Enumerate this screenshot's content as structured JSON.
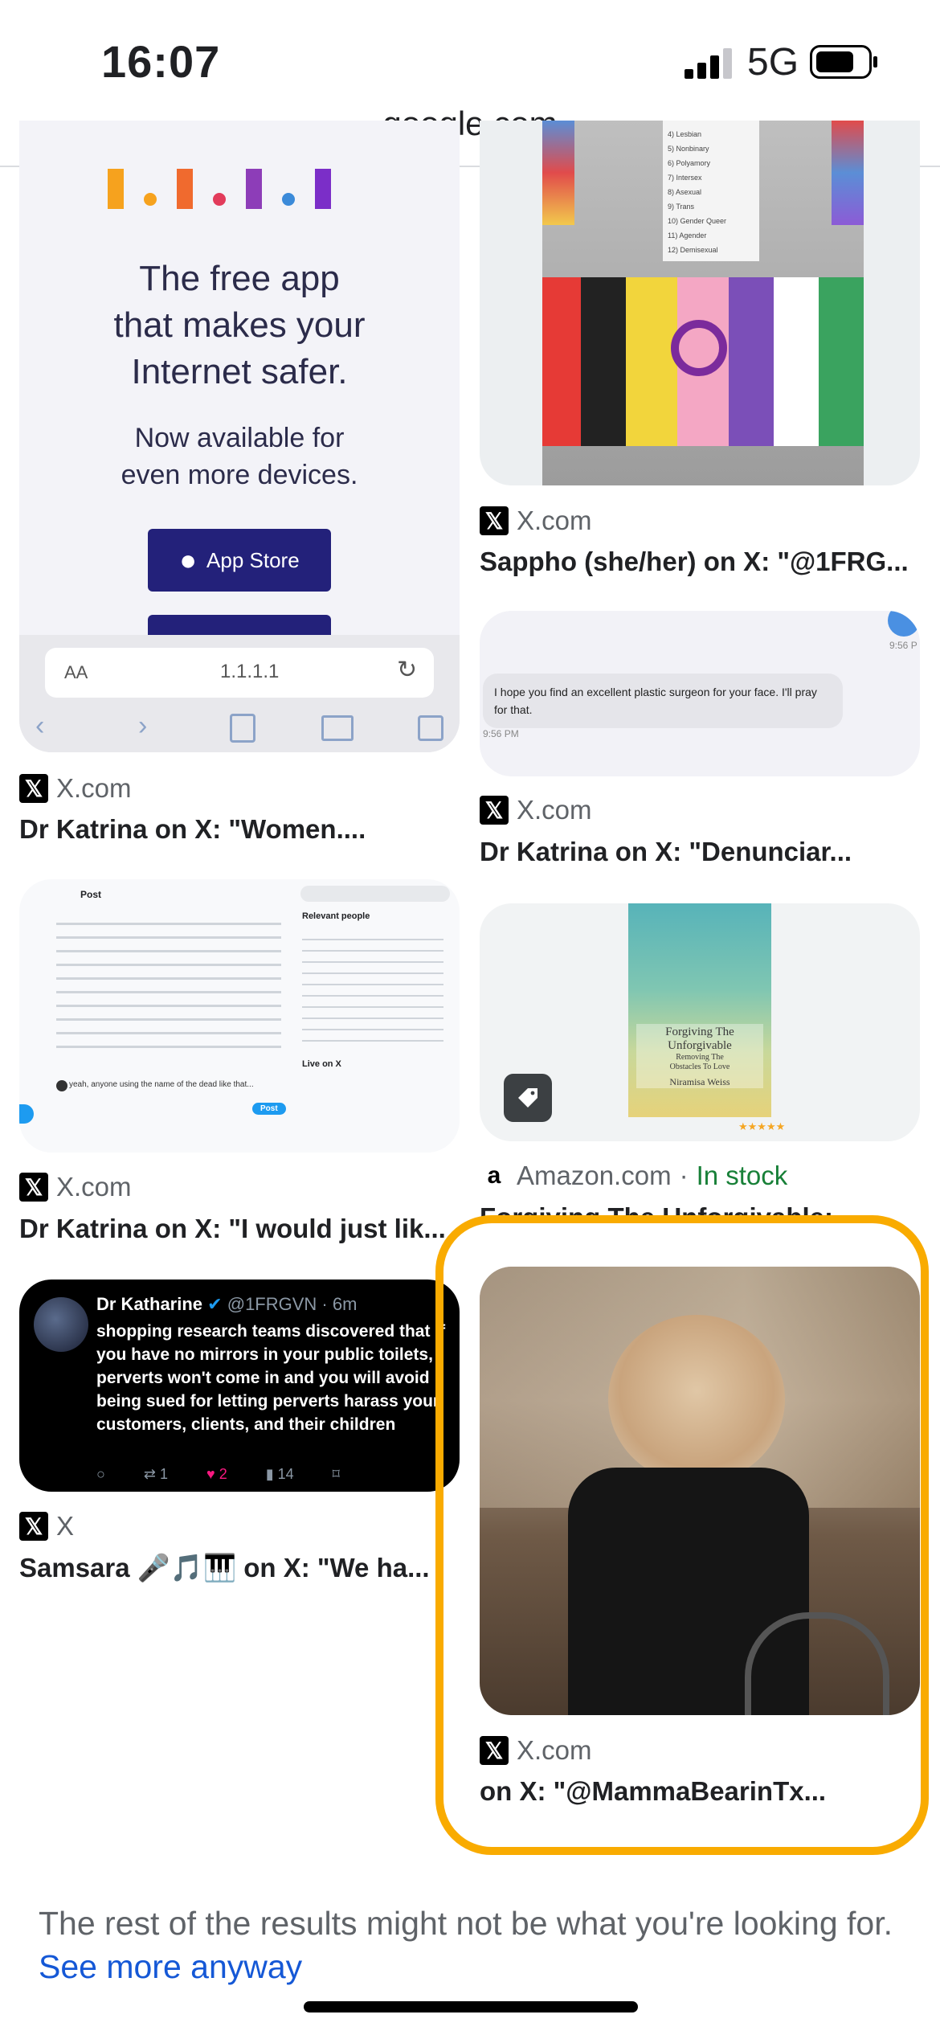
{
  "status": {
    "time": "16:07",
    "network": "5G"
  },
  "browser": {
    "url": "google.com"
  },
  "results": [
    {
      "source": "X.com",
      "title": "Dr Katrina on X: \"Women....",
      "image_text": {
        "line1": "The free app",
        "line2": "that makes your",
        "line3": "Internet safer.",
        "line4": "Now available for",
        "line5": "even more devices.",
        "button": "App Store",
        "address": "1.1.1.1",
        "aa": "AA"
      }
    },
    {
      "source": "X.com",
      "title": "Sappho (she/her) on X: \"@1FRG...",
      "image_text": {
        "list": [
          "4) Lesbian",
          "5) Nonbinary",
          "6) Polyamory",
          "7) Intersex",
          "8) Asexual",
          "9) Trans",
          "10) Gender Queer",
          "11) Agender",
          "12) Demisexual"
        ]
      }
    },
    {
      "source": "X.com",
      "title": "Dr Katrina on X: \"Denunciar...",
      "image_text": {
        "message": "I hope you find an excellent plastic surgeon for your face. I'll pray for that.",
        "time_left": "9:56 PM",
        "time_right": "9:56 P"
      }
    },
    {
      "source": "X.com",
      "title": "Dr Katrina on X: \"I would just lik...",
      "image_text": {
        "post": "Post",
        "relevant": "Relevant people",
        "live": "Live on X",
        "reply": "yeah, anyone using the name of the dead like that...",
        "post_button": "Post"
      }
    },
    {
      "source": "Amazon.com",
      "stock": "In stock",
      "title": "Forgiving The Unforgivable:",
      "image_text": {
        "book_title_1": "Forgiving The",
        "book_title_2": "Unforgivable",
        "book_sub_1": "Removing The",
        "book_sub_2": "Obstacles To Love",
        "author": "Niramisa Weiss",
        "stars": "★★★★★"
      }
    },
    {
      "source": "X",
      "title": "Samsara 🎤🎵🎹 on X: \"We ha...",
      "image_text": {
        "name": "Dr Katharine",
        "handle": "@1FRGVN · 6m",
        "body": "shopping research teams discovered that if you have no mirrors in your public toilets, perverts won't come in and you will avoid being sued for letting perverts harass your customers, clients, and their children",
        "retweets": "1",
        "likes": "2",
        "views": "14"
      }
    },
    {
      "source": "X.com",
      "title": "on X: \"@MammaBearinTx..."
    }
  ],
  "footer": {
    "text": "The rest of the results might not be what you're looking for.",
    "link": "See more anyway"
  },
  "colors": {
    "highlight": "#f9ab00",
    "link": "#1558d6",
    "in_stock": "#188038"
  }
}
